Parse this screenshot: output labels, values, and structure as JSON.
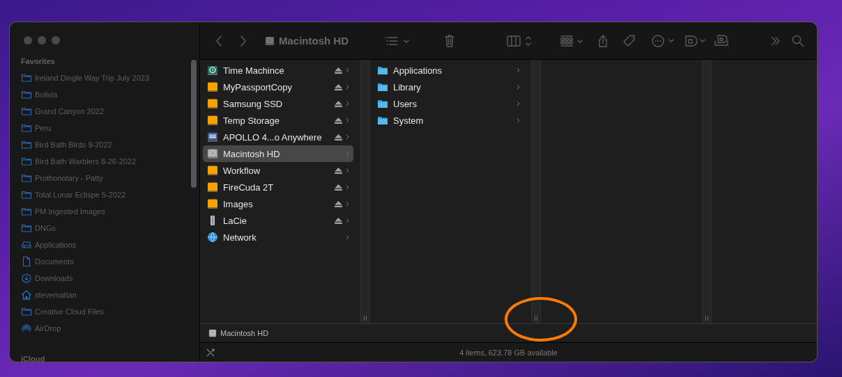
{
  "window": {
    "title": "Macintosh HD"
  },
  "sidebar": {
    "sections": [
      {
        "title": "Favorites",
        "items": [
          {
            "label": "Ireland Dingle Way Trip July 2023",
            "kind": "folder"
          },
          {
            "label": "Bolivia",
            "kind": "folder"
          },
          {
            "label": "Grand Canyon 2022",
            "kind": "folder"
          },
          {
            "label": "Peru",
            "kind": "folder"
          },
          {
            "label": "Bird Bath Birds 9-2022",
            "kind": "folder"
          },
          {
            "label": "Bird Bath Warblers 8-26-2022",
            "kind": "folder"
          },
          {
            "label": "Prothonotary - Patty",
            "kind": "folder"
          },
          {
            "label": "Total Lunar Eclispe 5-2022",
            "kind": "folder"
          },
          {
            "label": "PM Ingested Images",
            "kind": "folder"
          },
          {
            "label": "DNGs",
            "kind": "folder"
          },
          {
            "label": "Applications",
            "kind": "apps"
          },
          {
            "label": "Documents",
            "kind": "document"
          },
          {
            "label": "Downloads",
            "kind": "download"
          },
          {
            "label": "stevemattan",
            "kind": "home"
          },
          {
            "label": "Creative Cloud Files",
            "kind": "folder"
          },
          {
            "label": "AirDrop",
            "kind": "airdrop"
          }
        ]
      },
      {
        "title": "iCloud"
      }
    ]
  },
  "columns": [
    {
      "items": [
        {
          "label": "Time Machince",
          "kind": "timemachine",
          "ejectable": true,
          "selected": false
        },
        {
          "label": "MyPassportCopy",
          "kind": "external",
          "ejectable": true,
          "selected": false
        },
        {
          "label": "Samsung SSD",
          "kind": "external",
          "ejectable": true,
          "selected": false
        },
        {
          "label": "Temp Storage",
          "kind": "external",
          "ejectable": true,
          "selected": false
        },
        {
          "label": "APOLLO 4...o Anywhere",
          "kind": "device",
          "ejectable": true,
          "selected": false
        },
        {
          "label": "Macintosh HD",
          "kind": "internal",
          "ejectable": false,
          "selected": true
        },
        {
          "label": "Workflow",
          "kind": "external",
          "ejectable": true,
          "selected": false
        },
        {
          "label": "FireCuda 2T",
          "kind": "external",
          "ejectable": true,
          "selected": false
        },
        {
          "label": "Images",
          "kind": "external",
          "ejectable": true,
          "selected": false
        },
        {
          "label": "LaCie",
          "kind": "lacie",
          "ejectable": true,
          "selected": false
        },
        {
          "label": "Network",
          "kind": "network",
          "ejectable": false,
          "selected": false
        }
      ]
    },
    {
      "items": [
        {
          "label": "Applications",
          "kind": "folder",
          "ejectable": false,
          "selected": false
        },
        {
          "label": "Library",
          "kind": "folder",
          "ejectable": false,
          "selected": false
        },
        {
          "label": "Users",
          "kind": "folder",
          "ejectable": false,
          "selected": false
        },
        {
          "label": "System",
          "kind": "folder",
          "ejectable": false,
          "selected": false
        }
      ]
    }
  ],
  "path_bar": {
    "items": [
      "Macintosh HD"
    ]
  },
  "status_bar": {
    "text": "4 items, 623.78 GB available"
  }
}
